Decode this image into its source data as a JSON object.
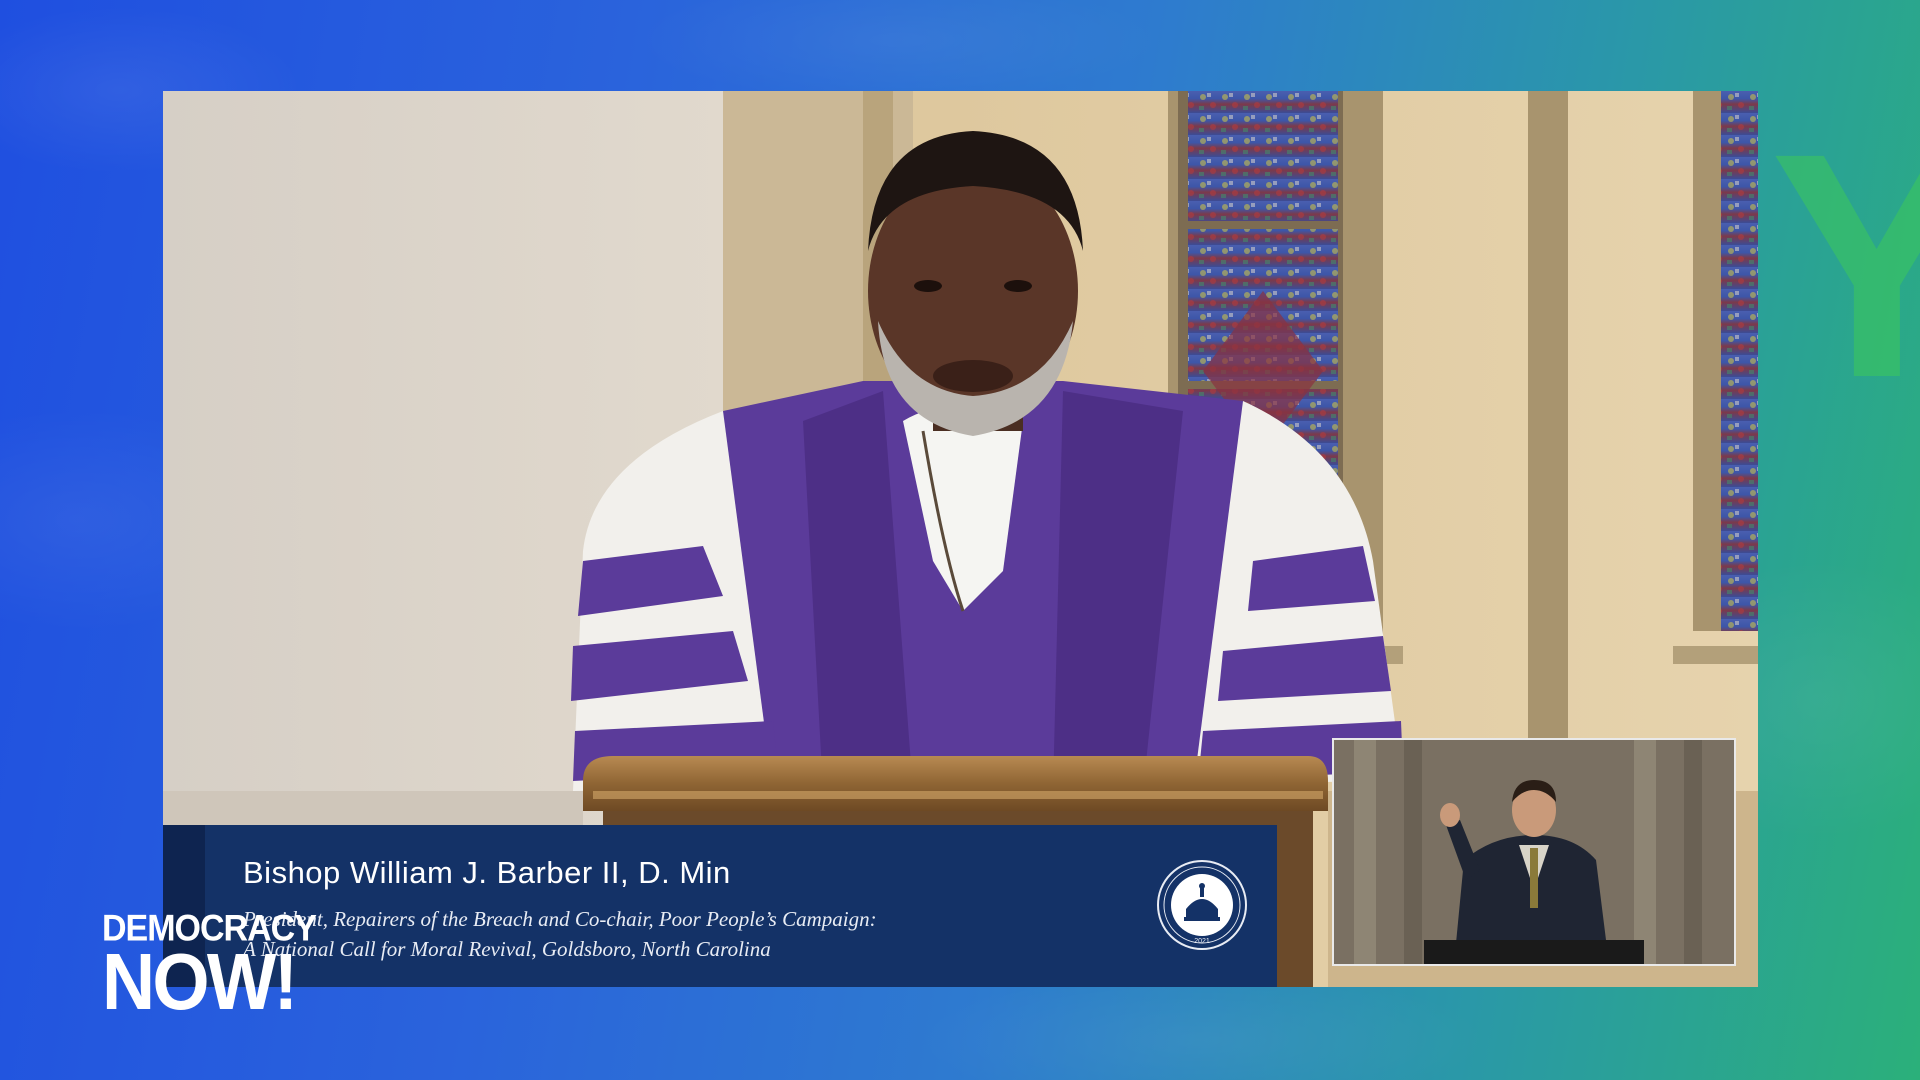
{
  "lower_third": {
    "name": "Bishop William J. Barber II, D. Min",
    "caption_line_1": "President, Repairers of the Breach and Co-chair, Poor People’s Campaign:",
    "caption_line_2": "A National Call for Moral Revival, Goldsboro, North Carolina"
  },
  "logo": {
    "line_1": "DEMOCRACY",
    "line_2": "NOW!"
  },
  "seal": {
    "icon": "inaugural-seal-icon",
    "text": "2021"
  },
  "background": {
    "letter": "Y"
  },
  "colors": {
    "lower_third_bg": "#143267",
    "robe_purple": "#5b3b9a",
    "background_blue": "#1f4fe0",
    "background_green": "#2bb07a"
  }
}
